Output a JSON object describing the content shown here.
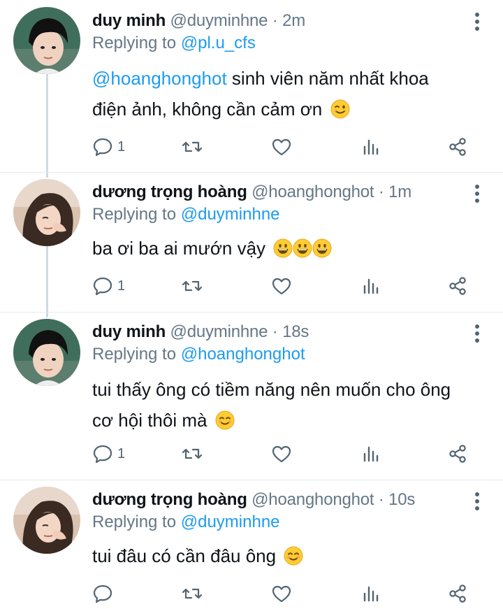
{
  "tweets": [
    {
      "name": "duy minh",
      "handle": "@duyminhne",
      "time": "2m",
      "replying_label": "Replying to",
      "replying_to": "@pl.u_cfs",
      "mention": "@hoanghonghot",
      "text": " sinh viên năm nhất khoa điện ảnh, không cần cảm ơn",
      "emojis": [
        "winking-face"
      ],
      "reply_count": "1"
    },
    {
      "name": "dương trọng hoàng",
      "handle": "@hoanghonghot",
      "time": "1m",
      "replying_label": "Replying to",
      "replying_to": "@duyminhne",
      "mention": "",
      "text": "ba ơi ba ai mướn vậy",
      "emojis": [
        "grinning-face",
        "grinning-face",
        "grinning-face"
      ],
      "reply_count": "1"
    },
    {
      "name": "duy minh",
      "handle": "@duyminhne",
      "time": "18s",
      "replying_label": "Replying to",
      "replying_to": "@hoanghonghot",
      "mention": "",
      "text": "tui thấy ông có tiềm năng nên muốn cho ông cơ hội thôi mà",
      "emojis": [
        "smiling-face"
      ],
      "reply_count": "1"
    },
    {
      "name": "dương trọng hoàng",
      "handle": "@hoanghonghot",
      "time": "10s",
      "replying_label": "Replying to",
      "replying_to": "@duyminhne",
      "mention": "",
      "text": "tui đâu có cần đâu ông",
      "emojis": [
        "smiling-face"
      ],
      "reply_count": ""
    }
  ],
  "separator": "·",
  "colors": {
    "link": "#1d9bf0",
    "secondary_text": "#657786",
    "thread_line": "#cfd9de",
    "icon": "#536471"
  },
  "icons": [
    "reply-icon",
    "retweet-icon",
    "like-icon",
    "analytics-icon",
    "share-icon",
    "more-options-icon"
  ]
}
